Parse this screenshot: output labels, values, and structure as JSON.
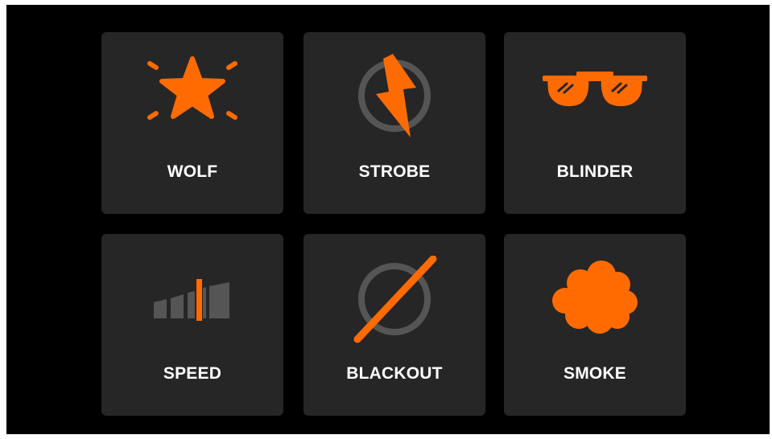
{
  "colors": {
    "accent": "#FF6B00",
    "tile_background": "#262626",
    "screen_background": "#000000",
    "icon_gray": "#555555",
    "label_text": "#FFFFFF"
  },
  "tiles": [
    {
      "label": "WOLF",
      "icon": "star-burst-icon"
    },
    {
      "label": "STROBE",
      "icon": "lightning-circle-icon"
    },
    {
      "label": "BLINDER",
      "icon": "sunglasses-icon"
    },
    {
      "label": "SPEED",
      "icon": "speed-bars-icon"
    },
    {
      "label": "BLACKOUT",
      "icon": "slashed-circle-icon"
    },
    {
      "label": "SMOKE",
      "icon": "smoke-cloud-icon"
    }
  ]
}
